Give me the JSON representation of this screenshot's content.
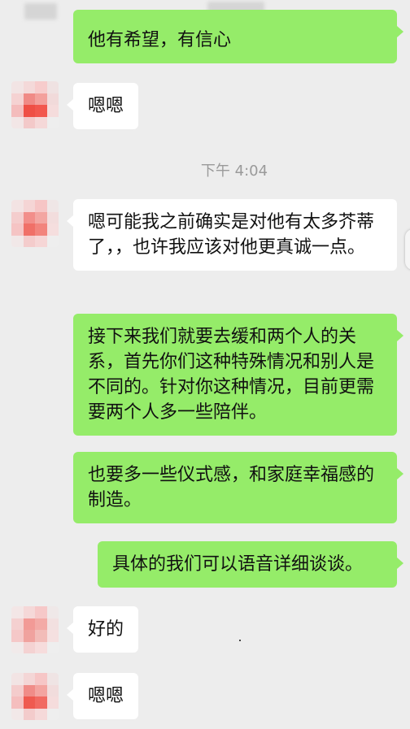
{
  "timestamp": "下午 4:04",
  "messages": [
    {
      "from": "self",
      "text": "他有希望，有信心"
    },
    {
      "from": "other",
      "text": "嗯嗯"
    },
    {
      "from": "other",
      "text": "嗯可能我之前确实是对他有太多芥蒂了，，也许我应该对他更真诚一点。"
    },
    {
      "from": "self",
      "text": "接下来我们就要去缓和两个人的关系，首先你们这种特殊情况和别人是不同的。针对你这种情况，目前更需要两个人多一些陪伴。"
    },
    {
      "from": "self",
      "text": "也要多一些仪式感，和家庭幸福感的制造。"
    },
    {
      "from": "self",
      "text": "具体的我们可以语音详细谈谈。"
    },
    {
      "from": "other",
      "text": "好的"
    },
    {
      "from": "other",
      "text": "嗯嗯"
    }
  ],
  "colors": {
    "background": "#ededed",
    "self_bubble": "#95ec69",
    "other_bubble": "#ffffff",
    "timestamp_text": "#9a9a9a"
  }
}
